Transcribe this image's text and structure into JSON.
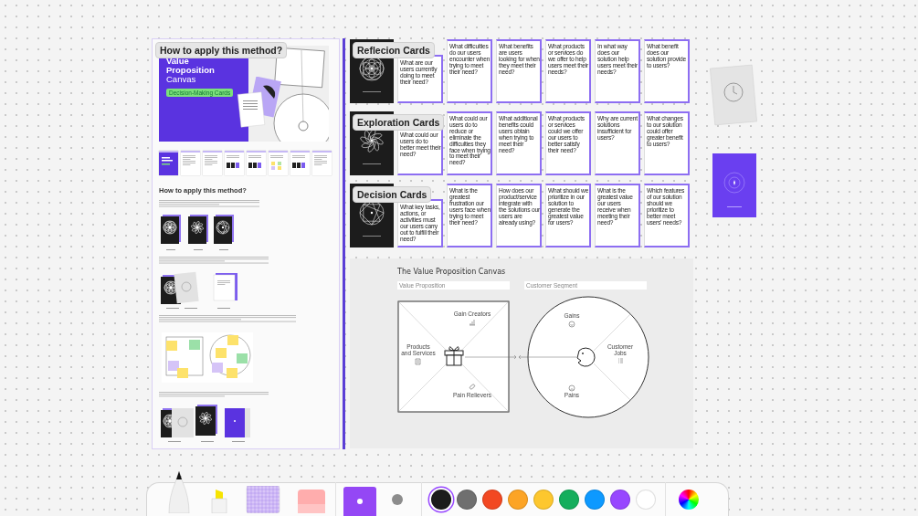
{
  "left_panel": {
    "label": "How to apply this method?",
    "cover": {
      "title": [
        "Value",
        "Proposition",
        "Canvas"
      ],
      "tag": "Decision-Making Cards"
    },
    "thumbnails": [
      {
        "kind": "cover"
      },
      {
        "kind": "text"
      },
      {
        "kind": "text"
      },
      {
        "kind": "cards"
      },
      {
        "kind": "cards"
      },
      {
        "kind": "stickies"
      },
      {
        "kind": "cards"
      },
      {
        "kind": "text"
      }
    ],
    "heading": "How to apply this method?"
  },
  "card_rows": [
    {
      "label": "Reflecion Cards",
      "cover": {
        "kind": "rings"
      },
      "questions": [
        "What are our users currently doing to meet their need?",
        "What difficulties do our users encounter when trying to meet their need?",
        "What benefits are users looking for when they meet their need?",
        "What products or services do we offer to help users meet their needs?",
        "In what way does our solution help users meet their needs?",
        "What benefit does our solution provide to users?"
      ]
    },
    {
      "label": "Exploration Cards",
      "cover": {
        "kind": "petals"
      },
      "questions": [
        "What could our users do to better meet their need?",
        "What could our users do to reduce or eliminate the difficulties they face when trying to meet their need?",
        "What additional benefits could users obtain when trying to meet their need?",
        "What products or services could we offer our users to better satisfy their need?",
        "Why are current solutions insufficient for users?",
        "What changes to our solution could offer greater benefit to users?"
      ]
    },
    {
      "label": "Decision Cards",
      "cover": {
        "kind": "star"
      },
      "questions": [
        "What key tasks, actions, or activities must our users carry out to fulfill their need?",
        "What is the greatest frustration our users face when trying to meet their need?",
        "How does our product/service integrate with the solutions our users are already using?",
        "What should we prioritize in our solution to generate the greatest value for users?",
        "What is the greatest value our users receive when meeting their need?",
        "Which features of our solution should we prioritize to better meet users' needs?"
      ]
    }
  ],
  "canvas": {
    "title": "The Value Proposition Canvas",
    "fields": [
      {
        "placeholder": "Value Proposition"
      },
      {
        "placeholder": "Customer Segment"
      }
    ],
    "sections": [
      {
        "kind": "gain-creators",
        "label": "Gain Creators"
      },
      {
        "kind": "products",
        "label": "Products and Services"
      },
      {
        "kind": "pain-relievers",
        "label": "Pain Relievers"
      },
      {
        "kind": "gains",
        "label": "Gains"
      },
      {
        "kind": "customer-jobs",
        "label": "Customer Jobs"
      },
      {
        "kind": "pains",
        "label": "Pains"
      }
    ]
  },
  "loose_cards": [
    {
      "kind": "clock"
    },
    {
      "kind": "star"
    }
  ],
  "toolbar": {
    "tools": [
      {
        "kind": "pen",
        "selected": true
      },
      {
        "kind": "highlighter",
        "selected": false
      },
      {
        "kind": "marker",
        "selected": false
      },
      {
        "kind": "eraser",
        "selected": false
      }
    ],
    "shape": {
      "color": "#9447f5"
    },
    "swatches": [
      {
        "color": "#1c1c1c",
        "selected": true
      },
      {
        "color": "#6f6f6f",
        "selected": false
      },
      {
        "color": "#f24822",
        "selected": false
      },
      {
        "color": "#fca426",
        "selected": false
      },
      {
        "color": "#fdc72e",
        "selected": false
      },
      {
        "color": "#14ae5c",
        "selected": false
      },
      {
        "color": "#0d99ff",
        "selected": false
      },
      {
        "color": "#9747ff",
        "selected": false
      },
      {
        "color": "#ffffff",
        "selected": false
      }
    ]
  }
}
